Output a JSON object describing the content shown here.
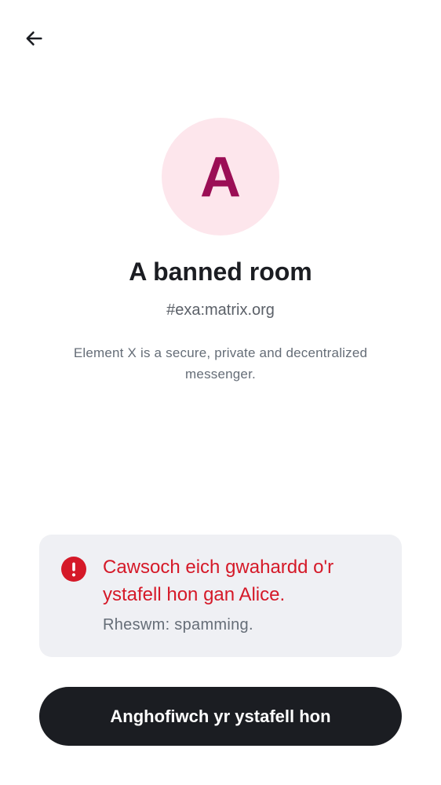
{
  "header": {
    "back_icon": "arrow-left-icon"
  },
  "room": {
    "avatar_letter": "A",
    "name": "A banned room",
    "alias": "#exa:matrix.org",
    "topic": "Element X is a secure, private and decentralized messenger."
  },
  "ban_notice": {
    "icon": "error-icon",
    "title": "Cawsoch eich gwahardd o'r ystafell hon gan Alice.",
    "reason": "Rheswm: spamming."
  },
  "actions": {
    "forget_label": "Anghofiwch yr ystafell hon"
  },
  "colors": {
    "avatar_bg": "#fde6ec",
    "avatar_fg": "#9b0e55",
    "critical": "#d51928",
    "button_bg": "#1b1d22",
    "card_bg": "#eff0f4"
  }
}
